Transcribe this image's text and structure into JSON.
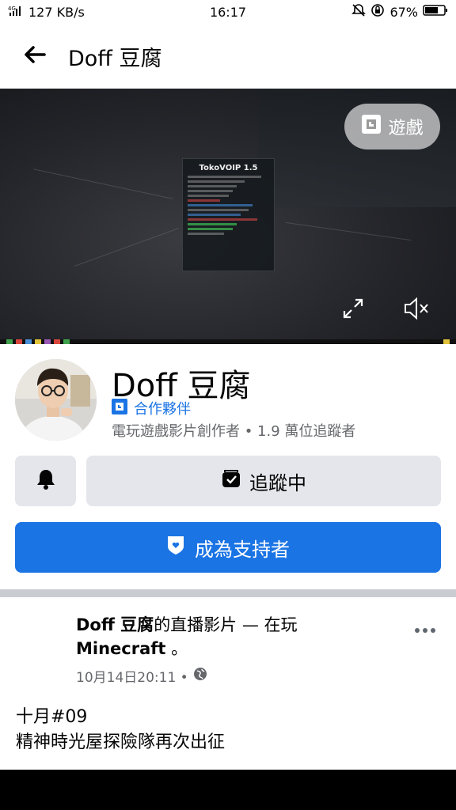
{
  "status_bar": {
    "carrier": "4G",
    "net_speed": "127 KB/s",
    "time": "16:17",
    "battery": "67%",
    "icons": [
      "signal-icon",
      "mute-icon",
      "alarm-icon",
      "battery-icon"
    ]
  },
  "app_bar": {
    "back_icon": "arrow-left-icon",
    "title": "Doff 豆腐"
  },
  "cover": {
    "game_pill_label": "遊戲",
    "overlay_title": "TokoVOIP 1.5",
    "icons": [
      "fullscreen-icon",
      "volume-mute-icon"
    ]
  },
  "profile": {
    "name": "Doff 豆腐",
    "partner_label": "合作夥伴",
    "meta": "電玩遊戲影片創作者 • 1.9 萬位追蹤者",
    "bell_icon": "bell-icon",
    "follow_label": "追蹤中",
    "support_label": "成為支持者"
  },
  "post": {
    "author": "Doff 豆腐",
    "action_text": "的直播影片 — 在玩",
    "game": "Minecraft",
    "trailing": "。",
    "timestamp": "10月14日20:11 •",
    "body_line1": "十月#09",
    "body_line2": "精神時光屋探險隊再次出征"
  },
  "colors": {
    "accent": "#1b74e4",
    "button_gray": "#e4e6eb",
    "secondary_text": "#65676b"
  }
}
